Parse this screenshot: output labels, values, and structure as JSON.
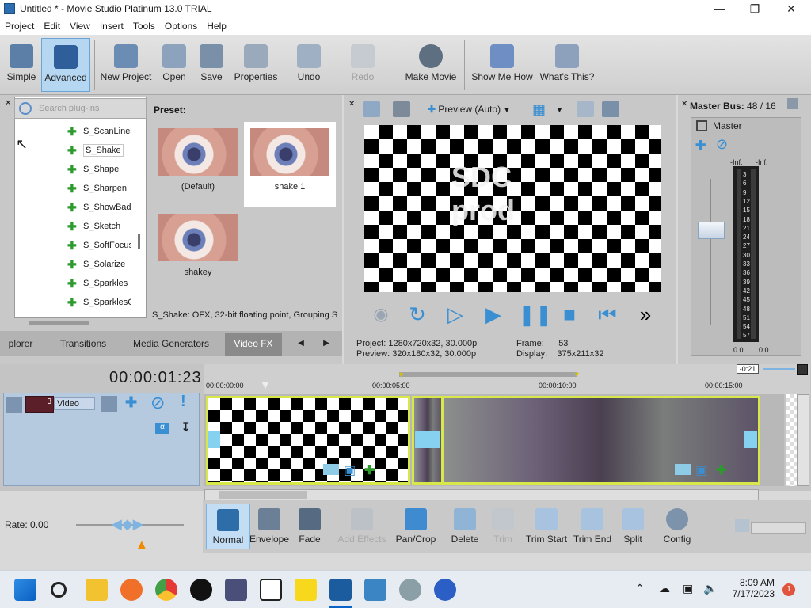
{
  "window": {
    "title": "Untitled * - Movie Studio Platinum 13.0 TRIAL"
  },
  "menu": [
    "Project",
    "Edit",
    "View",
    "Insert",
    "Tools",
    "Options",
    "Help"
  ],
  "toolbar": {
    "simple": "Simple",
    "advanced": "Advanced",
    "new_project": "New Project",
    "open": "Open",
    "save": "Save",
    "properties": "Properties",
    "undo": "Undo",
    "redo": "Redo",
    "make_movie": "Make Movie",
    "show_me_how": "Show Me How",
    "whats_this": "What's This?"
  },
  "plugins": {
    "search_placeholder": "Search plug-ins",
    "items": [
      "S_ScanLinesI",
      "S_Shake",
      "S_Shape",
      "S_Sharpen",
      "S_ShowBadC",
      "S_Sketch",
      "S_SoftFocus",
      "S_Solarize",
      "S_Sparkles",
      "S_SparklesCo"
    ],
    "selected": "S_Shake"
  },
  "presets": {
    "label": "Preset:",
    "items": [
      "(Default)",
      "shake 1",
      "shakey"
    ],
    "description": "S_Shake: OFX, 32-bit floating point, Grouping S"
  },
  "tabs": [
    "plorer",
    "Transitions",
    "Media Generators",
    "Video FX"
  ],
  "preview": {
    "mode": "Preview (Auto)",
    "overlay_text_1": "SDC",
    "overlay_text_2": "prod",
    "project_label": "Project:",
    "project_value": "1280x720x32, 30.000p",
    "preview_label": "Preview:",
    "preview_value": "320x180x32, 30.000p",
    "frame_label": "Frame:",
    "frame_value": "53",
    "display_label": "Display:",
    "display_value": "375x211x32"
  },
  "master": {
    "title": "Master Bus:",
    "value": "48 / 16",
    "label": "Master",
    "inf_left": "-Inf.",
    "inf_right": "-Inf.",
    "scale": [
      "3",
      "6",
      "9",
      "12",
      "15",
      "18",
      "21",
      "24",
      "27",
      "30",
      "33",
      "36",
      "39",
      "42",
      "45",
      "48",
      "51",
      "54",
      "57"
    ],
    "bottom_left": "0.0",
    "bottom_right": "0.0"
  },
  "timeline": {
    "timecode": "00:00:01:23",
    "track_number": "3",
    "track_name": "Video",
    "ruler": [
      "00:00:00:00",
      "00:00:05:00",
      "00:00:10:00",
      "00:00:15:00"
    ],
    "end_marker": "-0:21",
    "rate": "Rate: 0.00"
  },
  "edit_toolbar": {
    "normal": "Normal",
    "envelope": "Envelope",
    "fade": "Fade",
    "add_effects": "Add Effects",
    "pan_crop": "Pan/Crop",
    "delete": "Delete",
    "trim": "Trim",
    "trim_start": "Trim Start",
    "trim_end": "Trim End",
    "split": "Split",
    "config": "Config"
  },
  "taskbar": {
    "time": "8:09 AM",
    "date": "7/17/2023",
    "notifications": "1"
  },
  "colors": {
    "accent": "#3a8fd2",
    "selection": "#b6d7f2",
    "clip_border": "#d8e84a"
  }
}
